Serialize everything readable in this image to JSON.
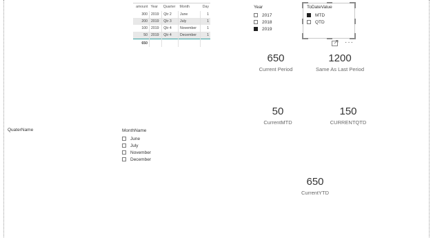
{
  "table": {
    "columns": [
      "amount",
      "Year",
      "Quarter",
      "Month",
      "Day"
    ],
    "rows": [
      [
        "300",
        "2019",
        "Qtr 2",
        "June",
        "1"
      ],
      [
        "200",
        "2019",
        "Qtr 3",
        "July",
        "1"
      ],
      [
        "100",
        "2019",
        "Qtr 4",
        "November",
        "1"
      ],
      [
        "50",
        "2019",
        "Qtr 4",
        "December",
        "1"
      ]
    ],
    "total": "650"
  },
  "year_slicer": {
    "title": "Year",
    "items": [
      {
        "label": "2017",
        "checked": false
      },
      {
        "label": "2018",
        "checked": false
      },
      {
        "label": "2019",
        "checked": true
      }
    ]
  },
  "todate_slicer": {
    "title": "ToDateValue",
    "items": [
      {
        "label": "MTD",
        "checked": true
      },
      {
        "label": "QTD",
        "checked": false
      }
    ]
  },
  "month_slicer": {
    "title": "MonthName",
    "items": [
      {
        "label": "June",
        "checked": false
      },
      {
        "label": "July",
        "checked": false
      },
      {
        "label": "November",
        "checked": false
      },
      {
        "label": "December",
        "checked": false
      }
    ]
  },
  "quarter_field": {
    "label": "QuaterName"
  },
  "cards": {
    "current_period": {
      "value": "650",
      "label": "Current Period"
    },
    "same_as_last": {
      "value": "1200",
      "label": "Same As Last Period"
    },
    "current_mtd": {
      "value": "50",
      "label": "CurrentMTD"
    },
    "current_qtd": {
      "value": "150",
      "label": "CURRENTQTD"
    },
    "current_ytd": {
      "value": "650",
      "label": "CurrentYTD"
    }
  },
  "icons": {
    "focus": "focus-mode-icon",
    "more": "more-options-icon"
  },
  "colors": {
    "checked": "#1f1f1f",
    "total_line": "#2fa0a0",
    "row_alt": "#e8e8e8"
  }
}
